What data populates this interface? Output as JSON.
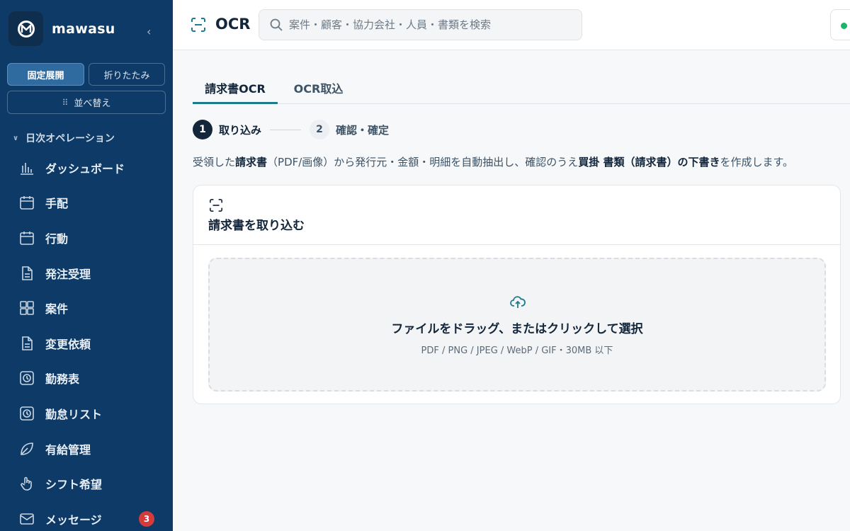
{
  "app": {
    "name": "mawasu",
    "logo_letter": "M"
  },
  "sidebar": {
    "mode_buttons": {
      "fixed": "固定展開",
      "fold": "折りたたみ"
    },
    "sort_label": "並べ替え",
    "section_label": "日次オペレーション",
    "items": [
      {
        "label": "ダッシュボード",
        "icon": "chart-icon"
      },
      {
        "label": "手配",
        "icon": "calendar-icon"
      },
      {
        "label": "行動",
        "icon": "calendar-icon"
      },
      {
        "label": "発注受理",
        "icon": "document-icon"
      },
      {
        "label": "案件",
        "icon": "grid-icon"
      },
      {
        "label": "変更依頼",
        "icon": "document-icon"
      },
      {
        "label": "勤務表",
        "icon": "clock-icon"
      },
      {
        "label": "勤怠リスト",
        "icon": "clock-icon"
      },
      {
        "label": "有給管理",
        "icon": "leaf-icon"
      },
      {
        "label": "シフト希望",
        "icon": "hand-icon"
      },
      {
        "label": "メッセージ",
        "icon": "mail-icon",
        "badge": "3"
      }
    ],
    "badge_color": "#d63b3b"
  },
  "header": {
    "title": "OCR",
    "search_placeholder": "案件・顧客・協力会社・人員・書類を検索",
    "status_color": "#1db36a"
  },
  "main": {
    "tabs": [
      {
        "label": "請求書OCR",
        "active": true
      },
      {
        "label": "OCR取込",
        "active": false
      }
    ],
    "steps": [
      {
        "num": "1",
        "label": "取り込み",
        "active": true
      },
      {
        "num": "2",
        "label": "確認・確定",
        "active": false
      }
    ],
    "description": {
      "p1": "受領した",
      "b1": "請求書",
      "p2": "（PDF/画像）から発行元・金額・明細を自動抽出し、確認のうえ",
      "b2": "買掛 書類（請求書）の下書き",
      "p3": "を作成します。"
    },
    "card": {
      "title": "請求書を取り込む",
      "dropzone_main": "ファイルをドラッグ、またはクリックして選択",
      "dropzone_sub": "PDF / PNG / JPEG / WebP / GIF・30MB 以下"
    }
  },
  "colors": {
    "sidebar_bg": "#0d3a66",
    "accent": "#1f7a8c",
    "text_dark": "#13263a"
  }
}
